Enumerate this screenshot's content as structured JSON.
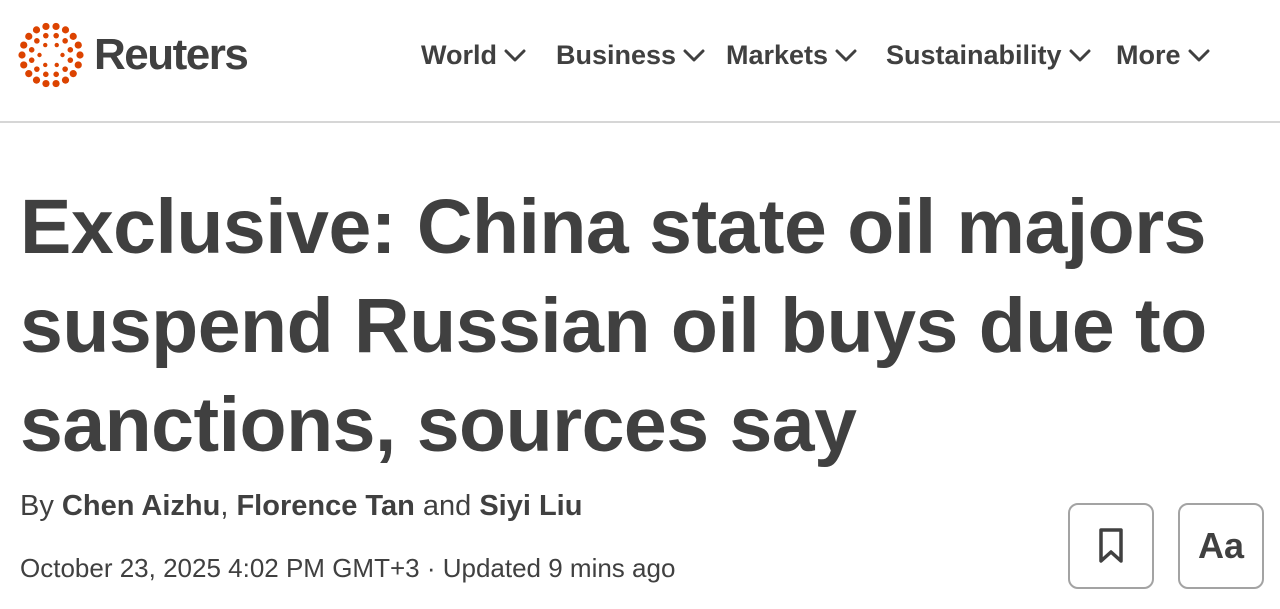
{
  "brand": {
    "name": "Reuters",
    "accent_color": "#dc4300"
  },
  "nav": {
    "items": [
      {
        "label": "World",
        "icon": "chevron-down-icon"
      },
      {
        "label": "Business",
        "icon": "chevron-down-icon"
      },
      {
        "label": "Markets",
        "icon": "chevron-down-icon"
      },
      {
        "label": "Sustainability",
        "icon": "chevron-down-icon"
      },
      {
        "label": "More",
        "icon": "chevron-down-icon"
      }
    ]
  },
  "article": {
    "headline": "Exclusive: China state oil majors suspend Russian oil buys due to sanctions, sources say",
    "byline": {
      "prefix": "By",
      "author1": "Chen Aizhu",
      "separator": ",",
      "author2": "Florence Tan",
      "conjunction": "and",
      "author3": "Siyi Liu"
    },
    "dateline": "October 23, 2025 4:02 PM GMT+3 · Updated 9 mins ago"
  },
  "actions": {
    "bookmark_icon": "bookmark-icon",
    "text_size_label": "Aa"
  }
}
